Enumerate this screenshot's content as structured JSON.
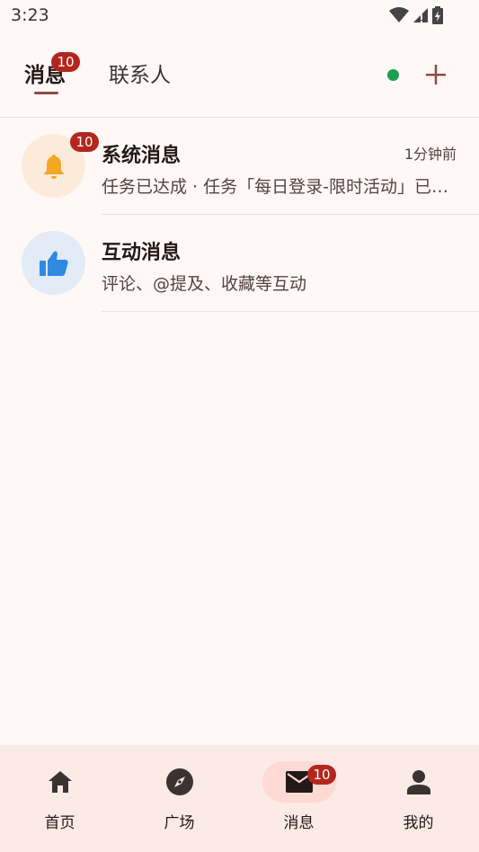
{
  "status_bar": {
    "time": "3:23"
  },
  "top_tabs": {
    "messages_label": "消息",
    "messages_badge": "10",
    "contacts_label": "联系人"
  },
  "messages": [
    {
      "title": "系统消息",
      "time": "1分钟前",
      "preview": "任务已达成 · 任务「每日登录-限时活动」已完成",
      "badge": "10",
      "icon": "bell-icon"
    },
    {
      "title": "互动消息",
      "time": "",
      "preview": "评论、@提及、收藏等互动",
      "badge": "",
      "icon": "thumbs-up-icon"
    }
  ],
  "bottom_nav": {
    "items": [
      {
        "label": "首页",
        "icon": "home-icon"
      },
      {
        "label": "广场",
        "icon": "compass-icon"
      },
      {
        "label": "消息",
        "icon": "mail-icon",
        "badge": "10",
        "active": true
      },
      {
        "label": "我的",
        "icon": "person-icon"
      }
    ]
  },
  "colors": {
    "background": "#fff8f6",
    "accent": "#904a44",
    "badge": "#b3261e",
    "online": "#1e9e50",
    "bell": "#f5a623",
    "like": "#2f8ae0",
    "nav_background": "#fceae7"
  }
}
